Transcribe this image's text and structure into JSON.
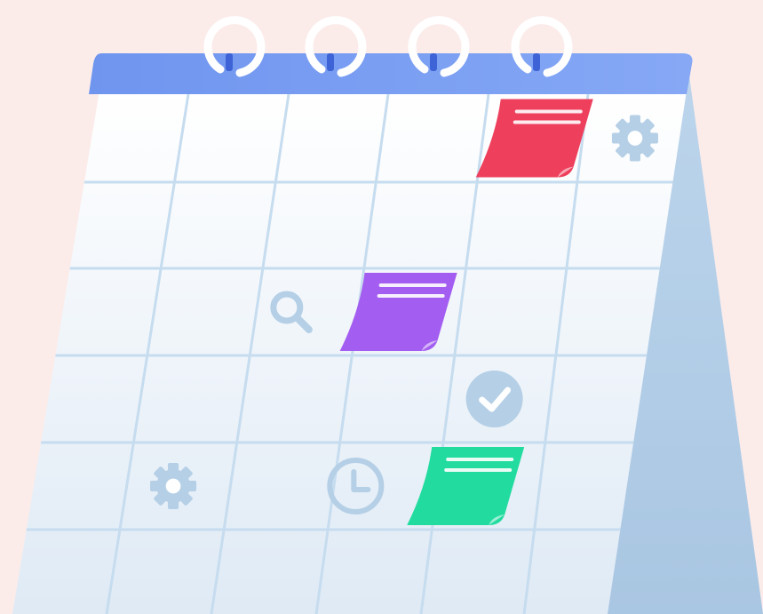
{
  "colors": {
    "background": "#fbecea",
    "header_blue": "#6f95ef",
    "header_blue_light": "#86a8f5",
    "grid_line": "#c6dcef",
    "page_white": "#ffffff",
    "page_fade": "#dfeaf5",
    "back_panel": "#b6d0e8",
    "back_panel_dark": "#a7c4e1",
    "ring_white": "#ffffff",
    "ring_post": "#3d63d6",
    "icon_blue": "#b4cfe6",
    "note_red": "#ee3f5c",
    "note_purple": "#a35df0",
    "note_green": "#22dc9f"
  },
  "calendar": {
    "rings": 4,
    "rows": 6,
    "columns": 6,
    "icons": [
      {
        "name": "gear-icon",
        "cell": [
          0,
          5
        ]
      },
      {
        "name": "search-icon",
        "cell": [
          2,
          2
        ]
      },
      {
        "name": "check-circle-icon",
        "cell": [
          3,
          4
        ]
      },
      {
        "name": "gear-icon",
        "cell": [
          4,
          1
        ]
      },
      {
        "name": "clock-icon",
        "cell": [
          4,
          3
        ]
      }
    ],
    "sticky_notes": [
      {
        "name": "sticky-note-red",
        "color": "note_red",
        "cell": [
          0,
          4
        ]
      },
      {
        "name": "sticky-note-purple",
        "color": "note_purple",
        "cell": [
          2,
          3
        ]
      },
      {
        "name": "sticky-note-green",
        "color": "note_green",
        "cell": [
          4,
          4
        ]
      }
    ]
  }
}
